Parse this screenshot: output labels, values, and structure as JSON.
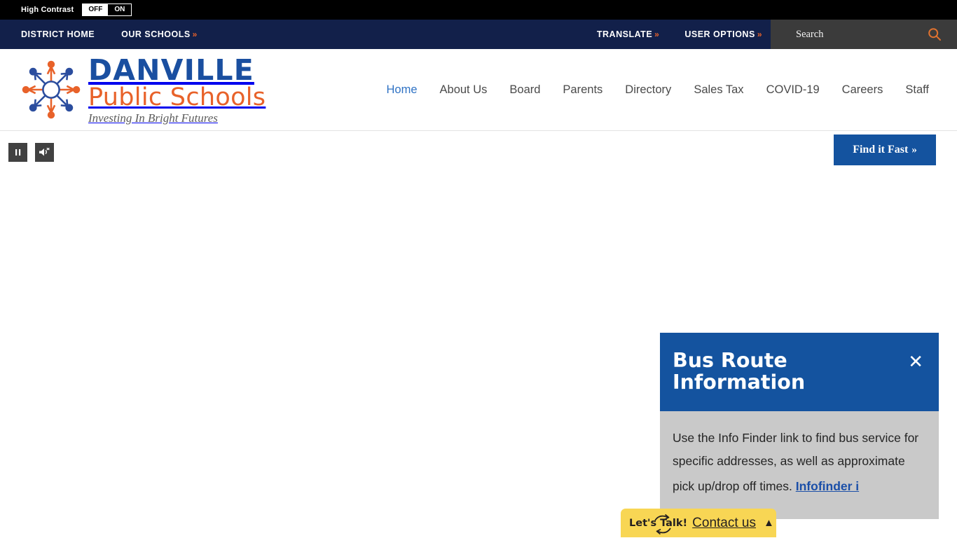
{
  "high_contrast": {
    "label": "High Contrast",
    "off_label": "OFF",
    "on_label": "ON"
  },
  "utility_bar": {
    "district_home": "DISTRICT HOME",
    "our_schools": "OUR SCHOOLS",
    "translate": "TRANSLATE",
    "user_options": "USER OPTIONS",
    "chevron": "»",
    "search_placeholder": "Search",
    "search_icon": "search-icon",
    "background_color": "#12204a",
    "search_background_color": "#3b3b3b",
    "accent_color": "#e8622a"
  },
  "brand": {
    "line1": "DANVILLE",
    "line2": "Public Schools",
    "tagline": "Investing In Bright Futures",
    "logo_icon": "compass-star-logo",
    "blue": "#1a4fa0",
    "orange": "#e8622a"
  },
  "main_nav": {
    "active": "Home",
    "items": [
      {
        "label": "Home"
      },
      {
        "label": "About Us"
      },
      {
        "label": "Board"
      },
      {
        "label": "Parents"
      },
      {
        "label": "Directory"
      },
      {
        "label": "Sales Tax"
      },
      {
        "label": "COVID-19"
      },
      {
        "label": "Careers"
      },
      {
        "label": "Staff"
      }
    ]
  },
  "stage": {
    "pause_icon": "pause-icon",
    "mute_icon": "speaker-mute-icon",
    "find_it_fast": "Find it Fast",
    "find_it_fast_chevron": "»",
    "find_it_fast_color": "#14539f"
  },
  "alert": {
    "title": "Bus Route Information",
    "close_icon": "close-icon",
    "body": "Use the Info Finder link to find bus service for specific addresses, as well as approximate pick up/drop off times.",
    "link_label": "Infofinder i",
    "header_color": "#14539f",
    "body_color": "#c9c9c9",
    "link_color": "#1b4fa8"
  },
  "lets_talk": {
    "brand": "Let's Talk!",
    "cycle_icon": "cycle-arrows-icon",
    "contact_label": "Contact us",
    "caret_icon": "caret-up-icon",
    "background_color": "#f8d654"
  }
}
